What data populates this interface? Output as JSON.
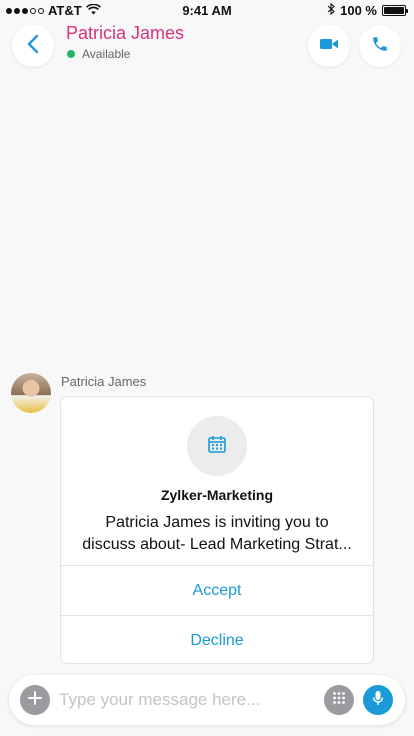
{
  "status_bar": {
    "carrier": "AT&T",
    "time": "9:41 AM",
    "battery": "100 %",
    "battery_level": 1.0
  },
  "header": {
    "contact_name": "Patricia James",
    "presence": "Available",
    "presence_color": "#22b566",
    "name_color": "#d6337a"
  },
  "chat": {
    "sender_name": "Patricia James",
    "invite_card": {
      "icon": "calendar-icon",
      "title": "Zylker-Marketing",
      "message_line1": "Patricia James is inviting you to",
      "message_line2": "discuss about- Lead Marketing Strat...",
      "accept_label": "Accept",
      "decline_label": "Decline",
      "accent_color": "#1a9ad6"
    }
  },
  "composer": {
    "placeholder": "Type your message here..."
  }
}
